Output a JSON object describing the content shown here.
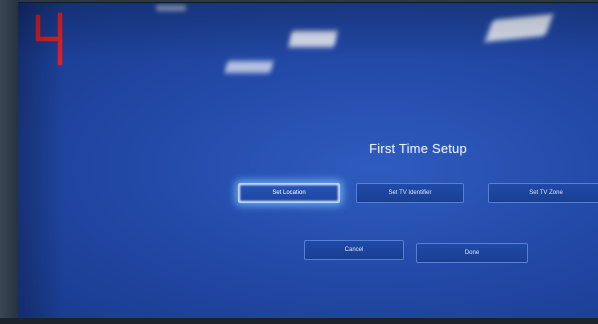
{
  "setup": {
    "title": "First Time Setup",
    "buttons": {
      "set_location": "Set Location",
      "set_tv_identifier": "Set TV Identifier",
      "set_tv_zone": "Set TV Zone",
      "cancel": "Cancel",
      "done": "Done"
    },
    "selected": "set_location"
  },
  "overlay": {
    "channel_digit": "4",
    "digit_color": "#e4202a"
  },
  "colors": {
    "screen_blue": "#234aa8",
    "button_border": "#5680d8",
    "focus_glow": "#78beff"
  }
}
